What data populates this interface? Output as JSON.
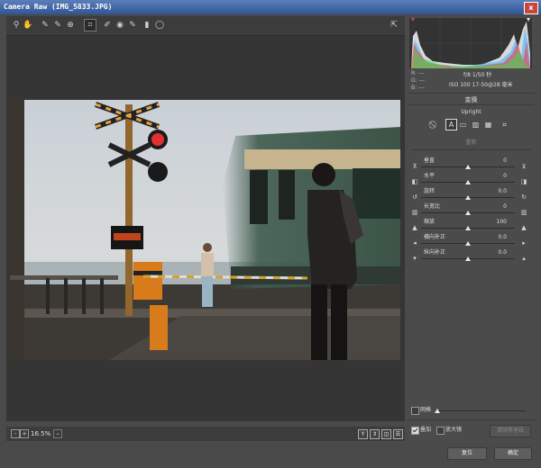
{
  "window": {
    "title": "Camera Raw (IMG_5833.JPG)",
    "close_glyph": "x"
  },
  "toolbar": {
    "tools": [
      {
        "name": "zoom-tool",
        "glyph": "⚲"
      },
      {
        "name": "hand-tool",
        "glyph": "✋"
      },
      {
        "name": "white-balance-tool",
        "glyph": "✎"
      },
      {
        "name": "color-sampler-tool",
        "glyph": "✎"
      },
      {
        "name": "targeted-adjustment-tool",
        "glyph": "⊕"
      },
      {
        "name": "crop-tool",
        "glyph": "⌗"
      },
      {
        "name": "spot-removal-tool",
        "glyph": "✐"
      },
      {
        "name": "red-eye-tool",
        "glyph": "◉"
      },
      {
        "name": "adjustment-brush-tool",
        "glyph": "✎"
      },
      {
        "name": "graduated-filter-tool",
        "glyph": "▮"
      },
      {
        "name": "radial-filter-tool",
        "glyph": "◯"
      }
    ],
    "open_prefs_glyph": "⇱"
  },
  "exif": {
    "r": "R:  ---",
    "g": "G:  ---",
    "b": "B:  ---",
    "line1": "f/8   1/50 秒",
    "line2": "ISO 100   17-50@28 毫米"
  },
  "transform": {
    "section_title": "变换",
    "upright_title": "Upright",
    "upright_buttons": [
      "⃠",
      "A",
      "▭",
      "▥",
      "▦",
      "⌗"
    ],
    "reanalyze_label": "重新"
  },
  "sliders": [
    {
      "label": "垂直",
      "value": "0",
      "pos": 0.5
    },
    {
      "label": "水平",
      "value": "0",
      "pos": 0.5
    },
    {
      "label": "旋转",
      "value": "0.0",
      "pos": 0.5
    },
    {
      "label": "长宽比",
      "value": "0",
      "pos": 0.5
    },
    {
      "label": "缩放",
      "value": "100",
      "pos": 0.5
    },
    {
      "label": "横向补正",
      "value": "0.0",
      "pos": 0.5
    },
    {
      "label": "纵向补正",
      "value": "0.0",
      "pos": 0.5
    }
  ],
  "grid": {
    "label": "网格",
    "checked": false
  },
  "overlay": {
    "label": "叠加",
    "checked": true
  },
  "loupe": {
    "label": "放大镜",
    "checked": false
  },
  "clear_guides_label": "清除参考线",
  "bottom": {
    "zoom_out": "-",
    "zoom_in": "+",
    "zoom_level": "16.5%",
    "dropdown": "⌄"
  },
  "view_buttons": [
    "Y",
    "⇕",
    "◫",
    "☰"
  ],
  "footer": {
    "reset_label": "复位",
    "ok_label": "确定"
  }
}
